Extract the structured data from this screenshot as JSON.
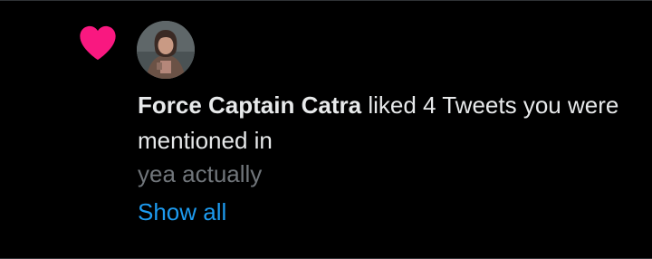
{
  "notification": {
    "icon": "heart-icon",
    "icon_color": "#f91880",
    "avatar": "user-avatar",
    "user_name": "Force Captain Catra",
    "action_text": "liked 4 Tweets you were mentioned in",
    "tweet_snippet": "yea actually",
    "show_all_label": "Show all"
  },
  "colors": {
    "background": "#000000",
    "primary_text": "#e7e9ea",
    "secondary_text": "#71767b",
    "link": "#1d9bf0"
  }
}
